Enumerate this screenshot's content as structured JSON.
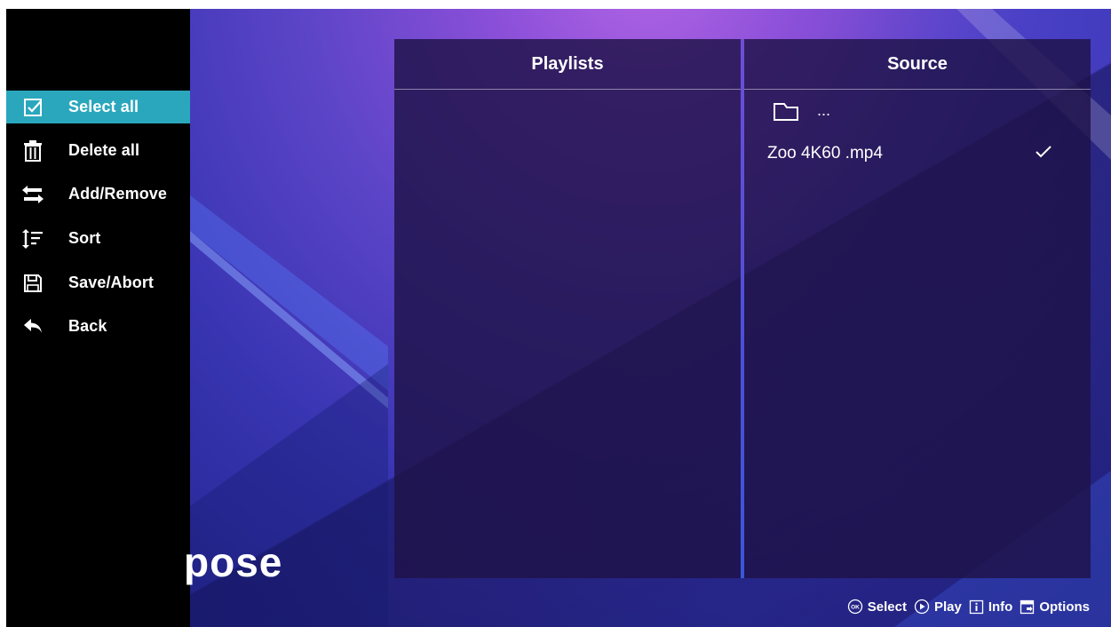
{
  "sidebar": {
    "items": [
      {
        "label": "Select all",
        "icon": "checkbox-icon",
        "active": true
      },
      {
        "label": "Delete all",
        "icon": "trash-icon",
        "active": false
      },
      {
        "label": "Add/Remove",
        "icon": "swap-arrows-icon",
        "active": false
      },
      {
        "label": "Sort",
        "icon": "sort-icon",
        "active": false
      },
      {
        "label": "Save/Abort",
        "icon": "save-icon",
        "active": false
      },
      {
        "label": "Back",
        "icon": "back-arrow-icon",
        "active": false
      }
    ]
  },
  "background": {
    "title": "pose"
  },
  "panels": {
    "playlists": {
      "title": "Playlists"
    },
    "source": {
      "title": "Source",
      "parent_label": "...",
      "files": [
        {
          "name": "Zoo 4K60 .mp4",
          "checked": true
        }
      ]
    }
  },
  "footer": {
    "hints": [
      {
        "label": "Select",
        "icon": "ok-button-icon"
      },
      {
        "label": "Play",
        "icon": "play-button-icon"
      },
      {
        "label": "Info",
        "icon": "info-button-icon"
      },
      {
        "label": "Options",
        "icon": "options-button-icon"
      }
    ]
  },
  "colors": {
    "accent": "#2aa7bd",
    "sidebar_bg": "#000000",
    "panel_bg": "#1e1248"
  }
}
